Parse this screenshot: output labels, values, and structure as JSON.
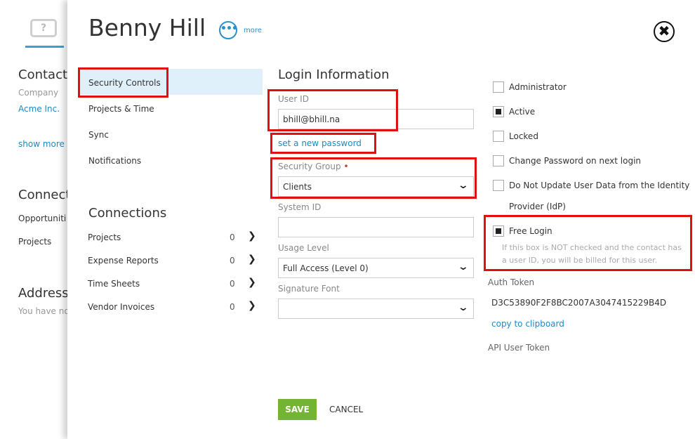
{
  "background": {
    "contact_heading": "Contact",
    "company_label": "Company",
    "company_value": "Acme Inc.",
    "show_more": "show more",
    "connections_heading": "Connect",
    "opportunities": "Opportuniti",
    "projects": "Projects",
    "address_heading": "Address",
    "address_empty": "You have no"
  },
  "header": {
    "title": "Benny Hill",
    "more_icon": "ellipsis-icon",
    "more_label": "more",
    "close_icon": "close-icon"
  },
  "nav": {
    "items": [
      {
        "label": "Security Controls",
        "active": true
      },
      {
        "label": "Projects & Time"
      },
      {
        "label": "Sync"
      },
      {
        "label": "Notifications"
      }
    ]
  },
  "connections": {
    "heading": "Connections",
    "items": [
      {
        "label": "Projects",
        "count": "0"
      },
      {
        "label": "Expense Reports",
        "count": "0"
      },
      {
        "label": "Time Sheets",
        "count": "0"
      },
      {
        "label": "Vendor Invoices",
        "count": "0"
      }
    ]
  },
  "login": {
    "heading": "Login Information",
    "user_id_label": "User ID",
    "user_id_value": "bhill@bhill.na",
    "set_password_link": "set a new password",
    "security_group_label": "Security Group",
    "required_marker": "•",
    "security_group_value": "Clients",
    "system_id_label": "System ID",
    "system_id_value": "",
    "usage_level_label": "Usage Level",
    "usage_level_value": "Full Access (Level 0)",
    "signature_font_label": "Signature Font",
    "signature_font_value": ""
  },
  "options": {
    "administrator": {
      "label": "Administrator",
      "checked": false
    },
    "active": {
      "label": "Active",
      "checked": true
    },
    "locked": {
      "label": "Locked",
      "checked": false
    },
    "change_password": {
      "label": "Change Password on next login",
      "checked": false
    },
    "no_update_line1": "Do Not Update User Data from the Identity",
    "no_update_line2": "Provider (IdP)",
    "free_login": {
      "label": "Free Login",
      "checked": true
    },
    "free_login_hint_line1": "If this box is NOT checked and the contact has",
    "free_login_hint_line2": "a user ID, you will be billed for this user.",
    "auth_token_label": "Auth Token",
    "auth_token_value": "D3C53890F2F8BC2007A3047415229B4D",
    "copy_link": "copy to clipboard",
    "api_token_label": "API User Token"
  },
  "footer": {
    "save": "SAVE",
    "cancel": "CANCEL"
  },
  "colors": {
    "accent": "#1a8ac6",
    "save_green": "#73b532",
    "highlight_red": "#e01010",
    "active_nav_bg": "#dff0fa"
  }
}
